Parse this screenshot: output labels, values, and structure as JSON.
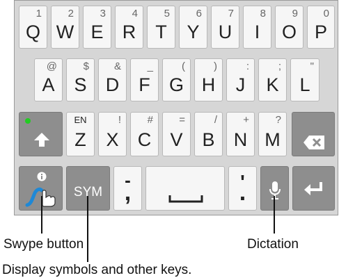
{
  "row1": [
    {
      "main": "Q",
      "sec": "1"
    },
    {
      "main": "W",
      "sec": "2"
    },
    {
      "main": "E",
      "sec": "3"
    },
    {
      "main": "R",
      "sec": "4"
    },
    {
      "main": "T",
      "sec": "5"
    },
    {
      "main": "Y",
      "sec": "6"
    },
    {
      "main": "U",
      "sec": "7"
    },
    {
      "main": "I",
      "sec": "8"
    },
    {
      "main": "O",
      "sec": "9"
    },
    {
      "main": "P",
      "sec": "0"
    }
  ],
  "row2": [
    {
      "main": "A",
      "sec": "@"
    },
    {
      "main": "S",
      "sec": "$"
    },
    {
      "main": "D",
      "sec": "&"
    },
    {
      "main": "F",
      "sec": "_"
    },
    {
      "main": "G",
      "sec": "("
    },
    {
      "main": "H",
      "sec": ")"
    },
    {
      "main": "J",
      "sec": ":"
    },
    {
      "main": "K",
      "sec": ";"
    },
    {
      "main": "L",
      "sec": "\""
    }
  ],
  "row3": [
    {
      "main": "Z",
      "sec": "EN"
    },
    {
      "main": "X",
      "sec": "!"
    },
    {
      "main": "C",
      "sec": "#"
    },
    {
      "main": "V",
      "sec": "="
    },
    {
      "main": "B",
      "sec": "/"
    },
    {
      "main": "N",
      "sec": "+"
    },
    {
      "main": "M",
      "sec": "?"
    }
  ],
  "row4": {
    "sym_label": "SYM",
    "dash_top": "-",
    "comma": ",",
    "apostrophe": "'",
    "period": "."
  },
  "annotations": {
    "swype": "Swype button",
    "dictation": "Dictation",
    "display_symbols": "Display symbols and other keys."
  },
  "colors": {
    "keyboard_bg": "#d6d6d6",
    "key_light": "#f6f6f6",
    "key_dark": "#8e8e8e",
    "shift_indicator": "#22cc22",
    "swype_trace": "#1e88d6"
  },
  "icons": [
    "shift-icon",
    "backspace-icon",
    "swype-icon",
    "info-icon",
    "hand-icon",
    "microphone-icon",
    "space-bar-icon",
    "enter-icon"
  ]
}
